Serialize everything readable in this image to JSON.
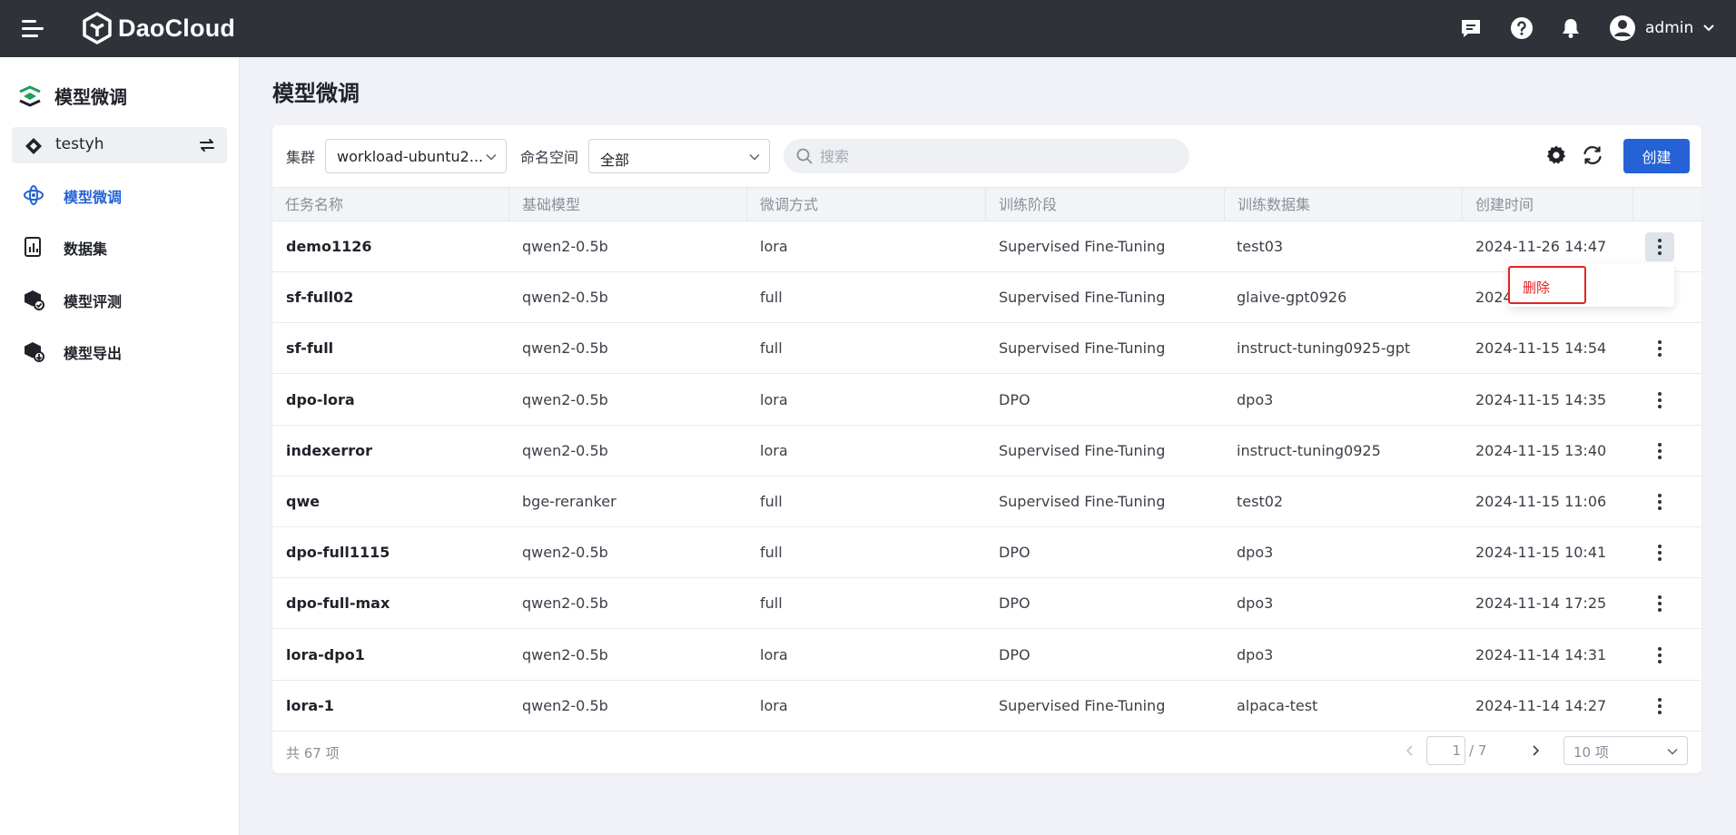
{
  "header": {
    "brand": "DaoCloud",
    "user_name": "admin",
    "icons": [
      "menu-icon",
      "message-icon",
      "help-icon",
      "bell-icon",
      "user-avatar-icon",
      "chevron-down-icon"
    ]
  },
  "sidebar": {
    "title": "模型微调",
    "workspace": "testyh",
    "items": [
      {
        "label": "模型微调",
        "icon": "model-tune-icon",
        "active": true
      },
      {
        "label": "数据集",
        "icon": "dataset-icon",
        "active": false
      },
      {
        "label": "模型评测",
        "icon": "model-eval-icon",
        "active": false
      },
      {
        "label": "模型导出",
        "icon": "model-export-icon",
        "active": false
      }
    ]
  },
  "main": {
    "title": "模型微调",
    "filters": {
      "cluster_label": "集群",
      "cluster_value": "workload-ubuntu2...",
      "namespace_label": "命名空间",
      "namespace_value": "全部",
      "search_placeholder": "搜索"
    },
    "create_label": "创建",
    "columns": [
      "任务名称",
      "基础模型",
      "微调方式",
      "训练阶段",
      "训练数据集",
      "创建时间"
    ],
    "rows": [
      {
        "name": "demo1126",
        "model": "qwen2-0.5b",
        "method": "lora",
        "stage": "Supervised Fine-Tuning",
        "dataset": "test03",
        "created": "2024-11-26 14:47"
      },
      {
        "name": "sf-full02",
        "model": "qwen2-0.5b",
        "method": "full",
        "stage": "Supervised Fine-Tuning",
        "dataset": "glaive-gpt0926",
        "created": "2024"
      },
      {
        "name": "sf-full",
        "model": "qwen2-0.5b",
        "method": "full",
        "stage": "Supervised Fine-Tuning",
        "dataset": "instruct-tuning0925-gpt",
        "created": "2024-11-15 14:54"
      },
      {
        "name": "dpo-lora",
        "model": "qwen2-0.5b",
        "method": "lora",
        "stage": "DPO",
        "dataset": "dpo3",
        "created": "2024-11-15 14:35"
      },
      {
        "name": "indexerror",
        "model": "qwen2-0.5b",
        "method": "lora",
        "stage": "Supervised Fine-Tuning",
        "dataset": "instruct-tuning0925",
        "created": "2024-11-15 13:40"
      },
      {
        "name": "qwe",
        "model": "bge-reranker",
        "method": "full",
        "stage": "Supervised Fine-Tuning",
        "dataset": "test02",
        "created": "2024-11-15 11:06"
      },
      {
        "name": "dpo-full1115",
        "model": "qwen2-0.5b",
        "method": "full",
        "stage": "DPO",
        "dataset": "dpo3",
        "created": "2024-11-15 10:41"
      },
      {
        "name": "dpo-full-max",
        "model": "qwen2-0.5b",
        "method": "full",
        "stage": "DPO",
        "dataset": "dpo3",
        "created": "2024-11-14 17:25"
      },
      {
        "name": "lora-dpo1",
        "model": "qwen2-0.5b",
        "method": "lora",
        "stage": "DPO",
        "dataset": "dpo3",
        "created": "2024-11-14 14:31"
      },
      {
        "name": "lora-1",
        "model": "qwen2-0.5b",
        "method": "lora",
        "stage": "Supervised Fine-Tuning",
        "dataset": "alpaca-test",
        "created": "2024-11-14 14:27"
      }
    ],
    "dropdown_delete": "删除",
    "pagination": {
      "total": "共 67 项",
      "current_page": "1",
      "total_pages": "/ 7",
      "page_size": "10 项"
    }
  },
  "colors": {
    "primary": "#2462d6",
    "danger": "#e02424",
    "topbar": "#2f3339"
  }
}
